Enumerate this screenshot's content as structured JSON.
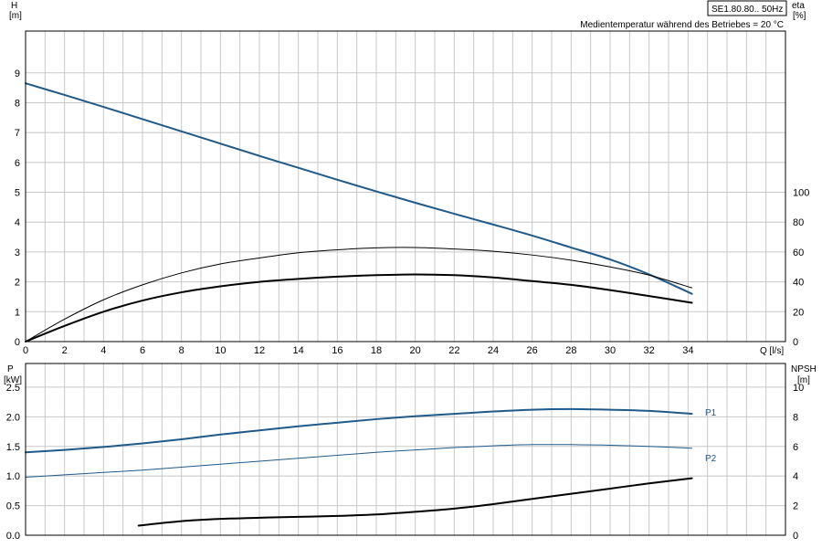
{
  "title": "SE1.80.80.. 50Hz",
  "note": "Medientemperatur während des Betriebes = 20 °C",
  "colors": {
    "blue": "#1f5a8a",
    "black": "#000000",
    "grid": "#c8c8c8"
  },
  "chart_data": [
    {
      "type": "line",
      "panel": "top",
      "xlabel": "Q [l/s]",
      "xlim": [
        0,
        39
      ],
      "x_ticks": [
        0,
        2,
        4,
        6,
        8,
        10,
        12,
        14,
        16,
        18,
        20,
        22,
        24,
        26,
        28,
        30,
        32,
        34
      ],
      "left_axis": {
        "label": "H",
        "unit": "[m]",
        "ylim": [
          0,
          10.4
        ],
        "ticks": [
          0,
          1,
          2,
          3,
          4,
          5,
          6,
          7,
          8,
          9
        ]
      },
      "right_axis": {
        "label": "eta",
        "unit": "[%]",
        "ylim": [
          0,
          208
        ],
        "ticks": [
          0,
          20,
          40,
          60,
          80,
          100
        ]
      },
      "series": [
        {
          "axis": "left",
          "color": "#1f5a8a",
          "width": 2,
          "x": [
            0,
            2,
            4,
            6,
            8,
            10,
            12,
            14,
            16,
            18,
            20,
            22,
            24,
            26,
            28,
            30,
            32,
            34.2
          ],
          "y": [
            8.65,
            8.26,
            7.86,
            7.45,
            7.04,
            6.63,
            6.22,
            5.82,
            5.42,
            5.03,
            4.65,
            4.28,
            3.92,
            3.55,
            3.15,
            2.75,
            2.25,
            1.6
          ]
        },
        {
          "axis": "right",
          "color": "#000000",
          "width": 1,
          "x": [
            0,
            2,
            4,
            6,
            8,
            10,
            12,
            14,
            16,
            18,
            20,
            22,
            24,
            26,
            28,
            30,
            32,
            34.2
          ],
          "y": [
            0,
            15,
            28,
            38,
            46,
            52,
            56,
            59.5,
            61.5,
            62.8,
            63,
            62,
            60.5,
            58,
            54.5,
            50,
            44.5,
            36
          ]
        },
        {
          "axis": "right",
          "color": "#000000",
          "width": 2,
          "x": [
            0,
            2,
            4,
            6,
            8,
            10,
            12,
            14,
            16,
            18,
            20,
            22,
            24,
            26,
            28,
            30,
            32,
            34.2
          ],
          "y": [
            0,
            10.5,
            20,
            27.5,
            33,
            37,
            40,
            42,
            43.5,
            44.5,
            45,
            44.5,
            43,
            40.5,
            38,
            34.5,
            30.5,
            26
          ]
        }
      ]
    },
    {
      "type": "line",
      "panel": "bottom",
      "xlim": [
        0,
        39
      ],
      "left_axis": {
        "label": "P",
        "unit": "[kW]",
        "ylim": [
          0,
          2.9
        ],
        "ticks": [
          "0.0",
          "0.5",
          "1.0",
          "1.5",
          "2.0",
          "2.5"
        ]
      },
      "right_axis": {
        "label": "NPSH",
        "unit": "[m]",
        "ylim": [
          0,
          11.6
        ],
        "ticks": [
          0,
          2,
          4,
          6,
          8,
          10
        ]
      },
      "series": [
        {
          "name": "P1",
          "axis": "left",
          "color": "#1f5a8a",
          "width": 2,
          "x": [
            0,
            2,
            4,
            6,
            8,
            10,
            12,
            14,
            16,
            18,
            20,
            22,
            24,
            26,
            28,
            30,
            32,
            34.2
          ],
          "y": [
            1.4,
            1.44,
            1.49,
            1.55,
            1.62,
            1.7,
            1.77,
            1.84,
            1.9,
            1.96,
            2.01,
            2.05,
            2.09,
            2.12,
            2.13,
            2.12,
            2.1,
            2.05
          ]
        },
        {
          "name": "P2",
          "axis": "left",
          "color": "#1f5a8a",
          "width": 1,
          "x": [
            0,
            2,
            4,
            6,
            8,
            10,
            12,
            14,
            16,
            18,
            20,
            22,
            24,
            26,
            28,
            30,
            32,
            34.2
          ],
          "y": [
            0.98,
            1.02,
            1.06,
            1.1,
            1.15,
            1.2,
            1.25,
            1.3,
            1.35,
            1.4,
            1.44,
            1.48,
            1.51,
            1.53,
            1.53,
            1.52,
            1.5,
            1.47
          ]
        },
        {
          "axis": "right",
          "color": "#000000",
          "width": 2,
          "x": [
            5.8,
            8,
            10,
            12,
            14,
            16,
            18,
            20,
            22,
            24,
            26,
            28,
            30,
            32,
            34.2
          ],
          "y": [
            0.65,
            0.95,
            1.1,
            1.18,
            1.24,
            1.3,
            1.4,
            1.58,
            1.8,
            2.1,
            2.45,
            2.8,
            3.15,
            3.5,
            3.85
          ]
        }
      ]
    }
  ]
}
